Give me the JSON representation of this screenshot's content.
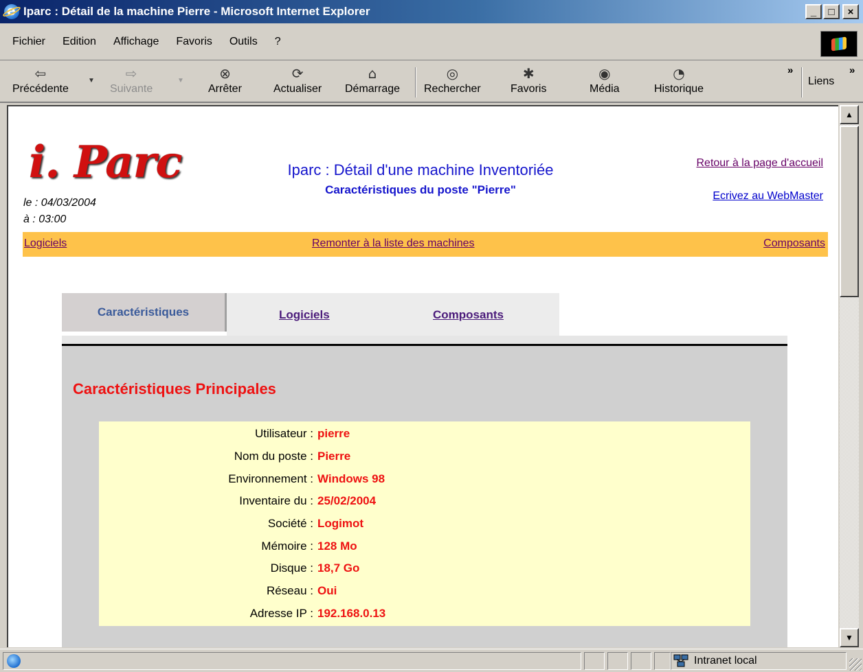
{
  "window": {
    "title": "Iparc : Détail de la machine Pierre - Microsoft Internet Explorer",
    "minimize": "_",
    "maximize": "□",
    "close": "×"
  },
  "menu": [
    "Fichier",
    "Edition",
    "Affichage",
    "Favoris",
    "Outils",
    "?"
  ],
  "toolbar": {
    "back": {
      "label": "Précédente",
      "icon": "back-arrow-icon"
    },
    "forward": {
      "label": "Suivante",
      "icon": "forward-arrow-icon"
    },
    "stop": {
      "label": "Arrêter",
      "icon": "stop-icon"
    },
    "refresh": {
      "label": "Actualiser",
      "icon": "refresh-icon"
    },
    "home": {
      "label": "Démarrage",
      "icon": "home-icon"
    },
    "search": {
      "label": "Rechercher",
      "icon": "search-icon"
    },
    "favorites": {
      "label": "Favoris",
      "icon": "favorites-icon"
    },
    "media": {
      "label": "Média",
      "icon": "media-icon"
    },
    "history": {
      "label": "Historique",
      "icon": "history-icon"
    },
    "links": "Liens",
    "chevron": "»"
  },
  "page": {
    "logo_text": "i. Parc",
    "date_line": "le : 04/03/2004",
    "time_line": "à : 03:00",
    "title": "Iparc : Détail d'une machine Inventoriée",
    "subtitle": "Caractéristiques du poste \"Pierre\"",
    "home_link": "Retour à la page d'accueil",
    "webmaster_link": "Ecrivez au WebMaster",
    "nav": {
      "left": "Logiciels",
      "center": "Remonter à la liste des machines",
      "right": "Composants"
    },
    "tabs": {
      "active": "Caractéristiques",
      "logiciels": "Logiciels",
      "composants": "Composants"
    },
    "section_title": "Caractéristiques Principales",
    "rows": [
      {
        "key": "Utilisateur :",
        "value": "pierre"
      },
      {
        "key": "Nom du poste :",
        "value": "Pierre"
      },
      {
        "key": "Environnement :",
        "value": "Windows 98"
      },
      {
        "key": "Inventaire du :",
        "value": "25/02/2004"
      },
      {
        "key": "Société :",
        "value": "Logimot"
      },
      {
        "key": "Mémoire :",
        "value": "128 Mo"
      },
      {
        "key": "Disque :",
        "value": "18,7 Go"
      },
      {
        "key": "Réseau :",
        "value": "Oui"
      },
      {
        "key": "Adresse IP :",
        "value": "192.168.0.13"
      }
    ]
  },
  "status": {
    "zone": "Intranet local"
  },
  "colors": {
    "nav_bar": "#fec24a",
    "title_blue": "#1414cc",
    "value_red": "#ee1111",
    "info_box": "#ffffcc"
  }
}
